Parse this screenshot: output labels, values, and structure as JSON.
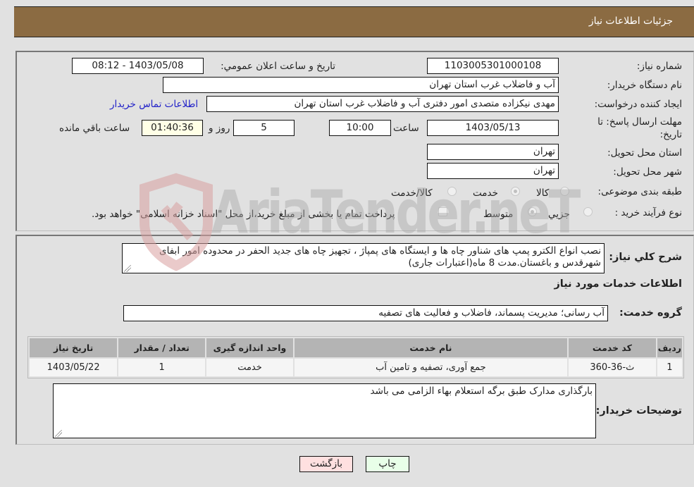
{
  "header": {
    "title": "جزئیات اطلاعات نیاز"
  },
  "form": {
    "need_number": {
      "label": "شماره نیاز:",
      "value": "1103005301000108"
    },
    "announce_datetime": {
      "label": "تاريخ و ساعت اعلان عمومي:",
      "value": "1403/05/08 - 08:12"
    },
    "buyer_org": {
      "label": "نام دستگاه خريدار:",
      "value": "آب و فاضلاب غرب استان تهران"
    },
    "requester": {
      "label": "ايجاد کننده درخواست:",
      "value": "مهدی نیکزاده متصدی امور دفتری آب و فاضلاب غرب استان تهران"
    },
    "buyer_contact_link": "اطلاعات تماس خريدار",
    "deadline": {
      "label": "مهلت ارسال پاسخ: تا تاریخ:",
      "date": "1403/05/13",
      "time_label": "ساعت",
      "time": "10:00",
      "days": "5",
      "days_label": "روز و",
      "remaining": "01:40:36",
      "remaining_label": "ساعت باقي مانده"
    },
    "delivery_province": {
      "label": "استان محل تحويل:",
      "value": "تهران"
    },
    "delivery_city": {
      "label": "شهر محل تحويل:",
      "value": "تهران"
    },
    "category": {
      "label": "طبقه بندی موضوعی:",
      "options": [
        "کالا",
        "خدمت",
        "کالا/خدمت"
      ],
      "selected": "خدمت"
    },
    "purchase_type": {
      "label": "نوع فرآيند خريد :",
      "options": [
        "جزيي",
        "متوسط"
      ],
      "selected": "متوسط",
      "treasury_checkbox_label": "پرداخت تمام يا بخشی از مبلغ خريد،از محل \"اسناد خزانه اسلامی\" خواهد بود.",
      "treasury_checked": false
    }
  },
  "description": {
    "label": "شرح کلي نياز:",
    "value": "نصب انواع الکترو پمپ های شناور چاه ها و ایستگاه های پمپاژ ، تجهیز چاه های جدید الحفر در محدوده امور ابفای شهرقدس و باغستان.مدت 8 ماه(اعتبارات جاری)"
  },
  "services_section": {
    "title": "اطلاعات خدمات مورد نياز",
    "group_label": "گروه خدمت:",
    "group_value": "آب رسانی؛ مدیریت پسماند، فاضلاب و فعالیت های تصفیه",
    "table": {
      "columns": [
        "رديف",
        "کد خدمت",
        "نام خدمت",
        "واحد اندازه گيری",
        "تعداد / مقدار",
        "تاريخ نياز"
      ],
      "rows": [
        [
          "1",
          "ث-36-360",
          "جمع آوری، تصفیه و تامین آب",
          "خدمت",
          "1",
          "1403/05/22"
        ]
      ]
    },
    "buyer_notes_label": "توضيحات خريدار:",
    "buyer_notes": "بارگذاری مدارک طبق برگه استعلام بهاء الزامی می باشد"
  },
  "buttons": {
    "print": "چاپ",
    "back": "بازگشت"
  },
  "watermark": {
    "text": "AriaTender.neT",
    "logo_color": "#d9a0a0",
    "text_color": "#a8a8a8"
  }
}
